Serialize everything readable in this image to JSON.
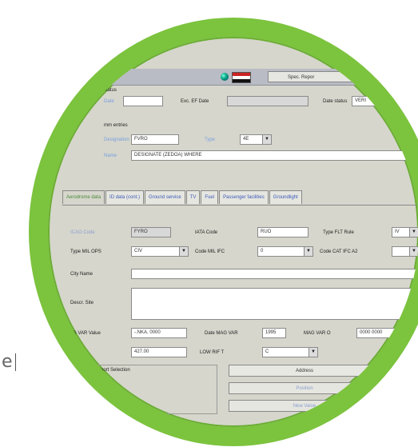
{
  "side_text": "e",
  "top": {
    "button_label": "Spec. Repor"
  },
  "section_status": {
    "heading": "status",
    "date_label": "Date",
    "end_label": "Exc. EF Date",
    "status_label": "Date status",
    "status_value": "VERI"
  },
  "section_airline": {
    "heading": "mm entries",
    "designation_label": "Designation",
    "designation_value": "FVRO",
    "type_label": "Type",
    "type_value": "4E",
    "name_label": "Name",
    "name_value": "DESIGNATE (ZEDOA) WHERE"
  },
  "tabs": [
    {
      "label": "Aerodrome data"
    },
    {
      "label": "ID data (cont.)"
    },
    {
      "label": "Ground service"
    },
    {
      "label": "TV"
    },
    {
      "label": "Fuel"
    },
    {
      "label": "Passenger facilities"
    },
    {
      "label": "Groundlight"
    }
  ],
  "detail": {
    "icao_label": "ICAO Code",
    "icao_value": "FYRO",
    "iata_label": "IATA Code",
    "iata_value": "RUO",
    "type_rule_label": "Type FLT Rule",
    "type_rule_value": "IV",
    "typemil_label": "Type MIL OPS",
    "typemil_value": "CIV",
    "code_mil_label": "Code MIL IFC",
    "code_mil_value": "0",
    "code_cat_label": "Code CAT IFC A2",
    "code_cat_value": "",
    "city_label": "City Name",
    "city_value": "",
    "desc_label": "Descr. Site",
    "desc_value": "",
    "magvar_label": "MAG VAR Value",
    "magvar_value": "-.NKA. 0000",
    "date_magvar_label": "Date MAG VAR",
    "date_magvar_value": "1995",
    "mag_var_c_label": "MAG VAR O",
    "mag_var_c_value": "0000 0000",
    "elev_label": "ev",
    "elev_value": "427.00",
    "low_rif_label": "LOW RIF T",
    "low_rif_value": "C"
  },
  "group": {
    "title": "...ome / Heliport Selection",
    "item": "...f aerodrome"
  },
  "buttons": {
    "address": "Address",
    "position": "Position",
    "next": "New Value"
  }
}
